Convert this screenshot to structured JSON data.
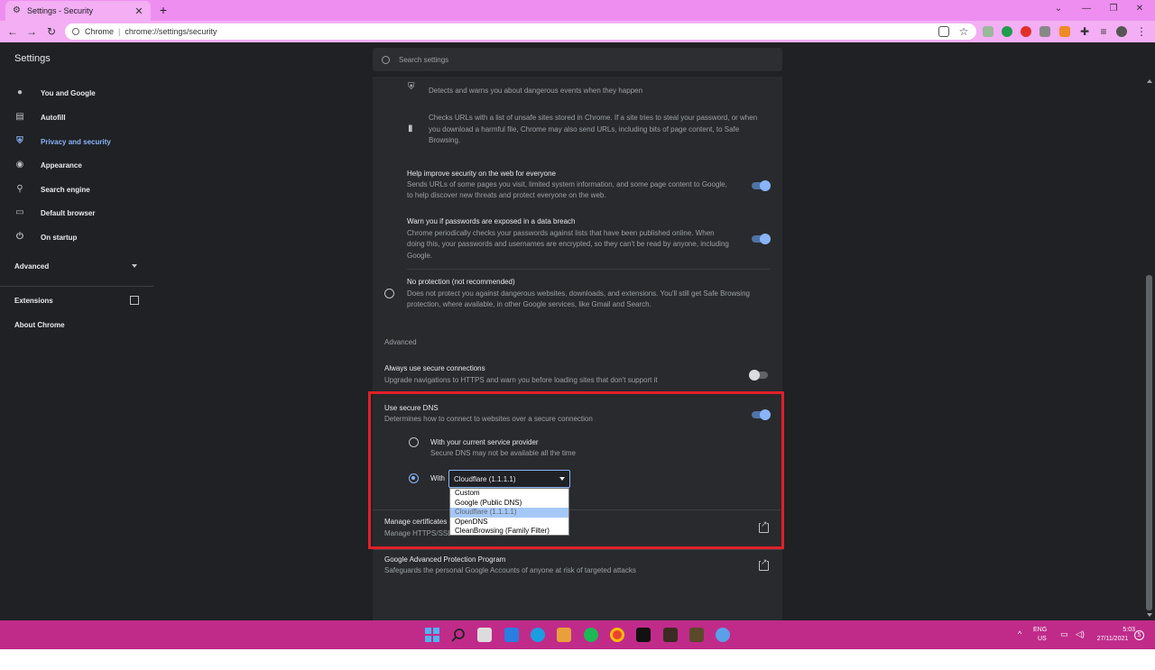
{
  "browser": {
    "tab_title": "Settings - Security",
    "tab_close": "✕",
    "new_tab": "+",
    "url_origin": "Chrome",
    "url_path": "chrome://settings/security"
  },
  "header": {
    "title": "Settings",
    "search_placeholder": "Search settings"
  },
  "sidebar": {
    "items": [
      {
        "label": "You and Google",
        "icon": "person-icon"
      },
      {
        "label": "Autofill",
        "icon": "clipboard-icon"
      },
      {
        "label": "Privacy and security",
        "icon": "shield-icon"
      },
      {
        "label": "Appearance",
        "icon": "palette-icon"
      },
      {
        "label": "Search engine",
        "icon": "search-icon"
      },
      {
        "label": "Default browser",
        "icon": "browser-icon"
      },
      {
        "label": "On startup",
        "icon": "power-icon"
      }
    ],
    "advanced": "Advanced",
    "extensions": "Extensions",
    "about": "About Chrome"
  },
  "content": {
    "detects_text": "Detects and warns you about dangerous events when they happen",
    "checks_text_1": "Checks URLs with a list of unsafe sites stored in Chrome. If a site tries to steal your password, or when",
    "checks_text_2": "you download a harmful file, Chrome may also send URLs, including bits of page content, to Safe",
    "checks_text_3": "Browsing.",
    "help_title": "Help improve security on the web for everyone",
    "help_sub_1": "Sends URLs of some pages you visit, limited system information, and some page content to Google,",
    "help_sub_2": "to help discover new threats and protect everyone on the web.",
    "help_toggle": true,
    "warn_title": "Warn you if passwords are exposed in a data breach",
    "warn_sub_1": "Chrome periodically checks your passwords against lists that have been published online. When",
    "warn_sub_2": "doing this, your passwords and usernames are encrypted, so they can't be read by anyone, including",
    "warn_sub_3": "Google.",
    "warn_toggle": true,
    "noprot_title": "No protection (not recommended)",
    "noprot_sub_1": "Does not protect you against dangerous websites, downloads, and extensions. You'll still get Safe Browsing",
    "noprot_sub_2": "protection, where available, in other Google services, like Gmail and Search.",
    "advanced_header": "Advanced",
    "https_title": "Always use secure connections",
    "https_sub": "Upgrade navigations to HTTPS and warn you before loading sites that don't support it",
    "https_toggle": false,
    "dns_title": "Use secure DNS",
    "dns_sub": "Determines how to connect to websites over a secure connection",
    "dns_toggle": true,
    "dns_current_title": "With your current service provider",
    "dns_current_sub": "Secure DNS may not be available all the time",
    "dns_with_label": "With",
    "dns_selected": "Cloudflare (1.1.1.1)",
    "dns_options": [
      "Custom",
      "Google (Public DNS)",
      "Cloudflare (1.1.1.1)",
      "OpenDNS",
      "CleanBrowsing (Family Filter)"
    ],
    "certs_title": "Manage certificates",
    "certs_sub": "Manage HTTPS/SSL",
    "gapp_title": "Google Advanced Protection Program",
    "gapp_sub": "Safeguards the personal Google Accounts of anyone at risk of targeted attacks"
  },
  "taskbar": {
    "lang_1": "ENG",
    "lang_2": "US",
    "time": "5:03",
    "date": "27/11/2021",
    "notif_count": "5"
  },
  "colors": {
    "accent": "#8ab4f8",
    "titlebar": "#ee8ef0",
    "taskbar": "#c02b8a",
    "highlight_box": "#e0202a"
  }
}
